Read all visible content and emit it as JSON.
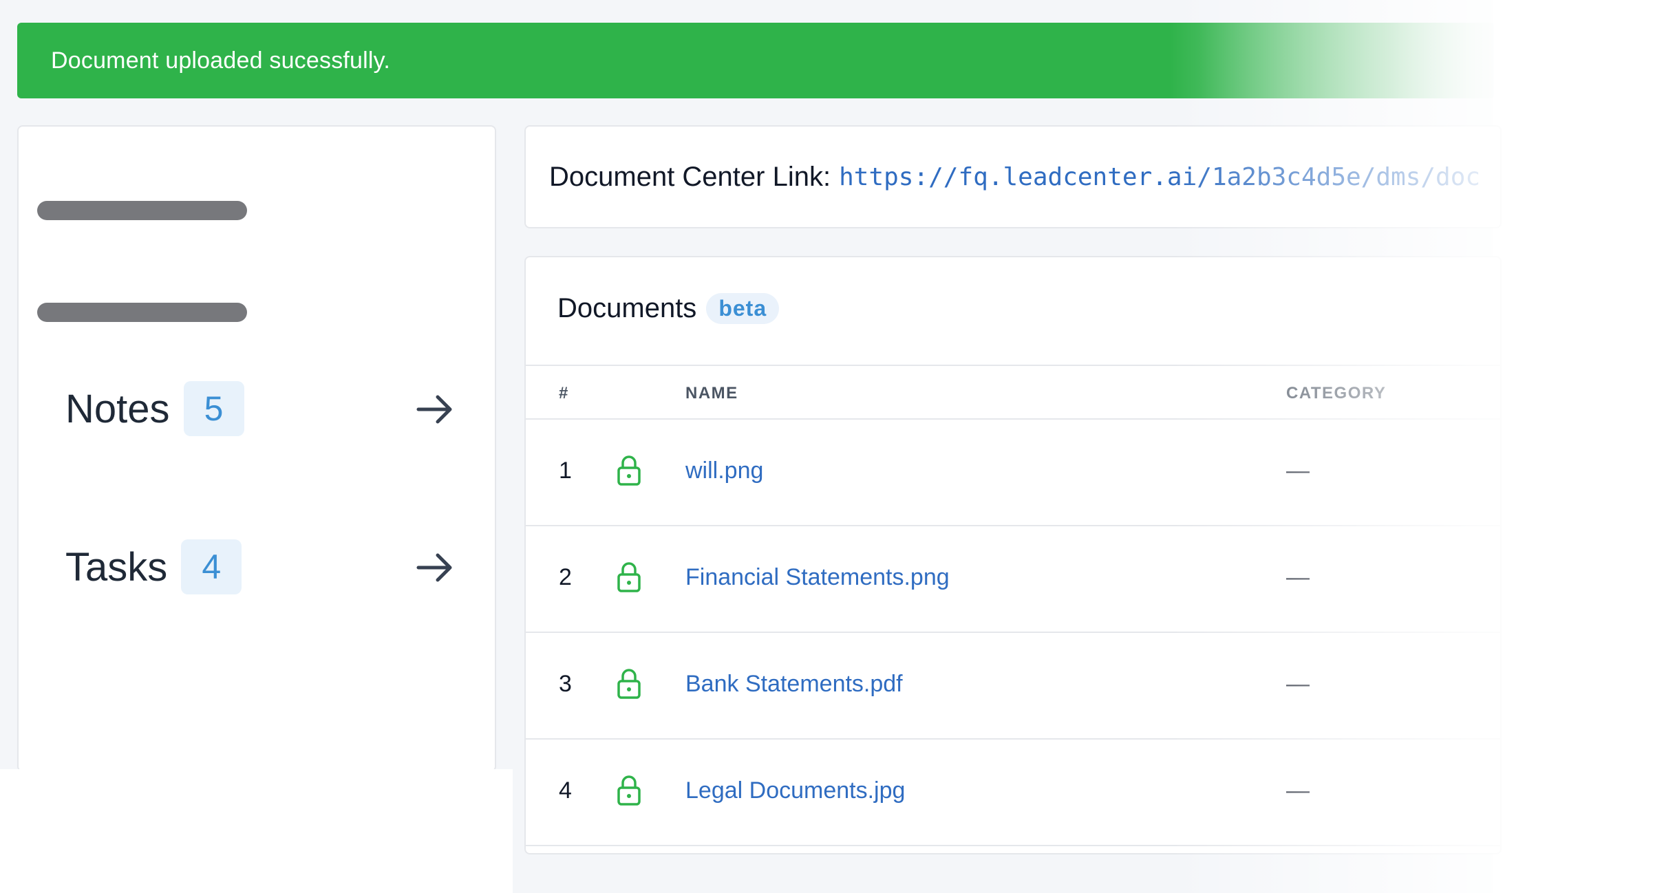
{
  "banner": {
    "message": "Document uploaded sucessfully."
  },
  "sidebar": {
    "items": [
      {
        "label": "Notes",
        "count": "5"
      },
      {
        "label": "Tasks",
        "count": "4"
      }
    ]
  },
  "document_link": {
    "label": "Document Center Link:",
    "url": "https://fq.leadcenter.ai/1a2b3c4d5e/dms/doc"
  },
  "documents": {
    "title": "Documents",
    "badge": "beta",
    "columns": {
      "number": "#",
      "name": "NAME",
      "category": "CATEGORY"
    },
    "rows": [
      {
        "number": "1",
        "name": "will.png",
        "category": "—",
        "icon": "lock-icon"
      },
      {
        "number": "2",
        "name": "Financial Statements.png",
        "category": "—",
        "icon": "lock-icon"
      },
      {
        "number": "3",
        "name": "Bank Statements.pdf",
        "category": "—",
        "icon": "lock-icon"
      },
      {
        "number": "4",
        "name": "Legal Documents.jpg",
        "category": "—",
        "icon": "lock-icon"
      }
    ]
  },
  "colors": {
    "success": "#2fb34a",
    "link": "#2f6cc1",
    "lock": "#2fb34a",
    "badge_text": "#3b8fd4"
  }
}
